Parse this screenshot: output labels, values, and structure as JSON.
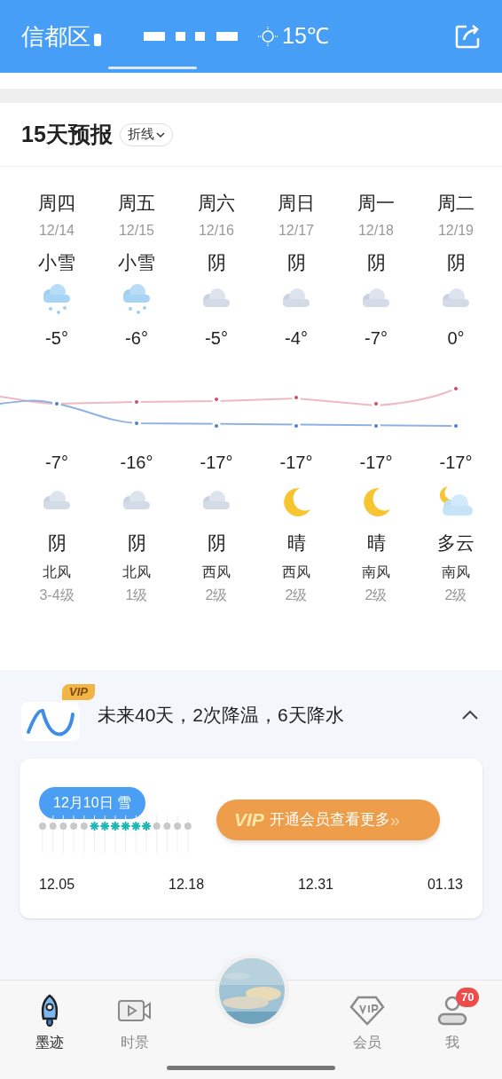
{
  "header": {
    "city": "信都区",
    "temperature": "15℃"
  },
  "forecast": {
    "title": "15天预报",
    "mode_toggle": "折线",
    "days": [
      {
        "weekday": "周四",
        "date": "12/14",
        "day": {
          "weather": "小雪",
          "kind": "snow"
        },
        "high": "-5°",
        "low": "-7°",
        "night": {
          "weather": "阴",
          "kind": "cloudy"
        },
        "wind": "北风",
        "wind_level": "3-4级"
      },
      {
        "weekday": "周五",
        "date": "12/15",
        "day": {
          "weather": "小雪",
          "kind": "snow"
        },
        "high": "-6°",
        "low": "-16°",
        "night": {
          "weather": "阴",
          "kind": "cloudy"
        },
        "wind": "北风",
        "wind_level": "1级"
      },
      {
        "weekday": "周六",
        "date": "12/16",
        "day": {
          "weather": "阴",
          "kind": "cloudy"
        },
        "high": "-5°",
        "low": "-17°",
        "night": {
          "weather": "阴",
          "kind": "cloudy"
        },
        "wind": "西风",
        "wind_level": "2级"
      },
      {
        "weekday": "周日",
        "date": "12/17",
        "day": {
          "weather": "阴",
          "kind": "cloudy"
        },
        "high": "-4°",
        "low": "-17°",
        "night": {
          "weather": "晴",
          "kind": "moon"
        },
        "wind": "西风",
        "wind_level": "2级"
      },
      {
        "weekday": "周一",
        "date": "12/18",
        "day": {
          "weather": "阴",
          "kind": "cloudy"
        },
        "high": "-7°",
        "low": "-17°",
        "night": {
          "weather": "晴",
          "kind": "moon"
        },
        "wind": "南风",
        "wind_level": "2级"
      },
      {
        "weekday": "周二",
        "date": "12/19",
        "day": {
          "weather": "阴",
          "kind": "cloudy"
        },
        "high": "0°",
        "low": "-17°",
        "night": {
          "weather": "多云",
          "kind": "moon-cloud"
        },
        "wind": "南风",
        "wind_level": "2级"
      }
    ]
  },
  "trend": {
    "vip_badge": "VIP",
    "summary": "未来40天，2次降温，6天降水",
    "expanded": true,
    "selected_day": "12月10日 雪",
    "vip_button": {
      "logo": "VIP",
      "label": "开通会员查看更多",
      "arrows": "»"
    },
    "axis_labels": [
      "12.05",
      "12.18",
      "12.31",
      "01.13"
    ]
  },
  "bottom_nav": [
    {
      "label": "墨迹",
      "selected": true,
      "kind": "rocket"
    },
    {
      "label": "时景",
      "selected": false,
      "kind": "video"
    },
    {
      "label": "会员",
      "selected": false,
      "kind": "vip"
    },
    {
      "label": "我",
      "selected": false,
      "kind": "user",
      "badge": "70"
    }
  ]
}
